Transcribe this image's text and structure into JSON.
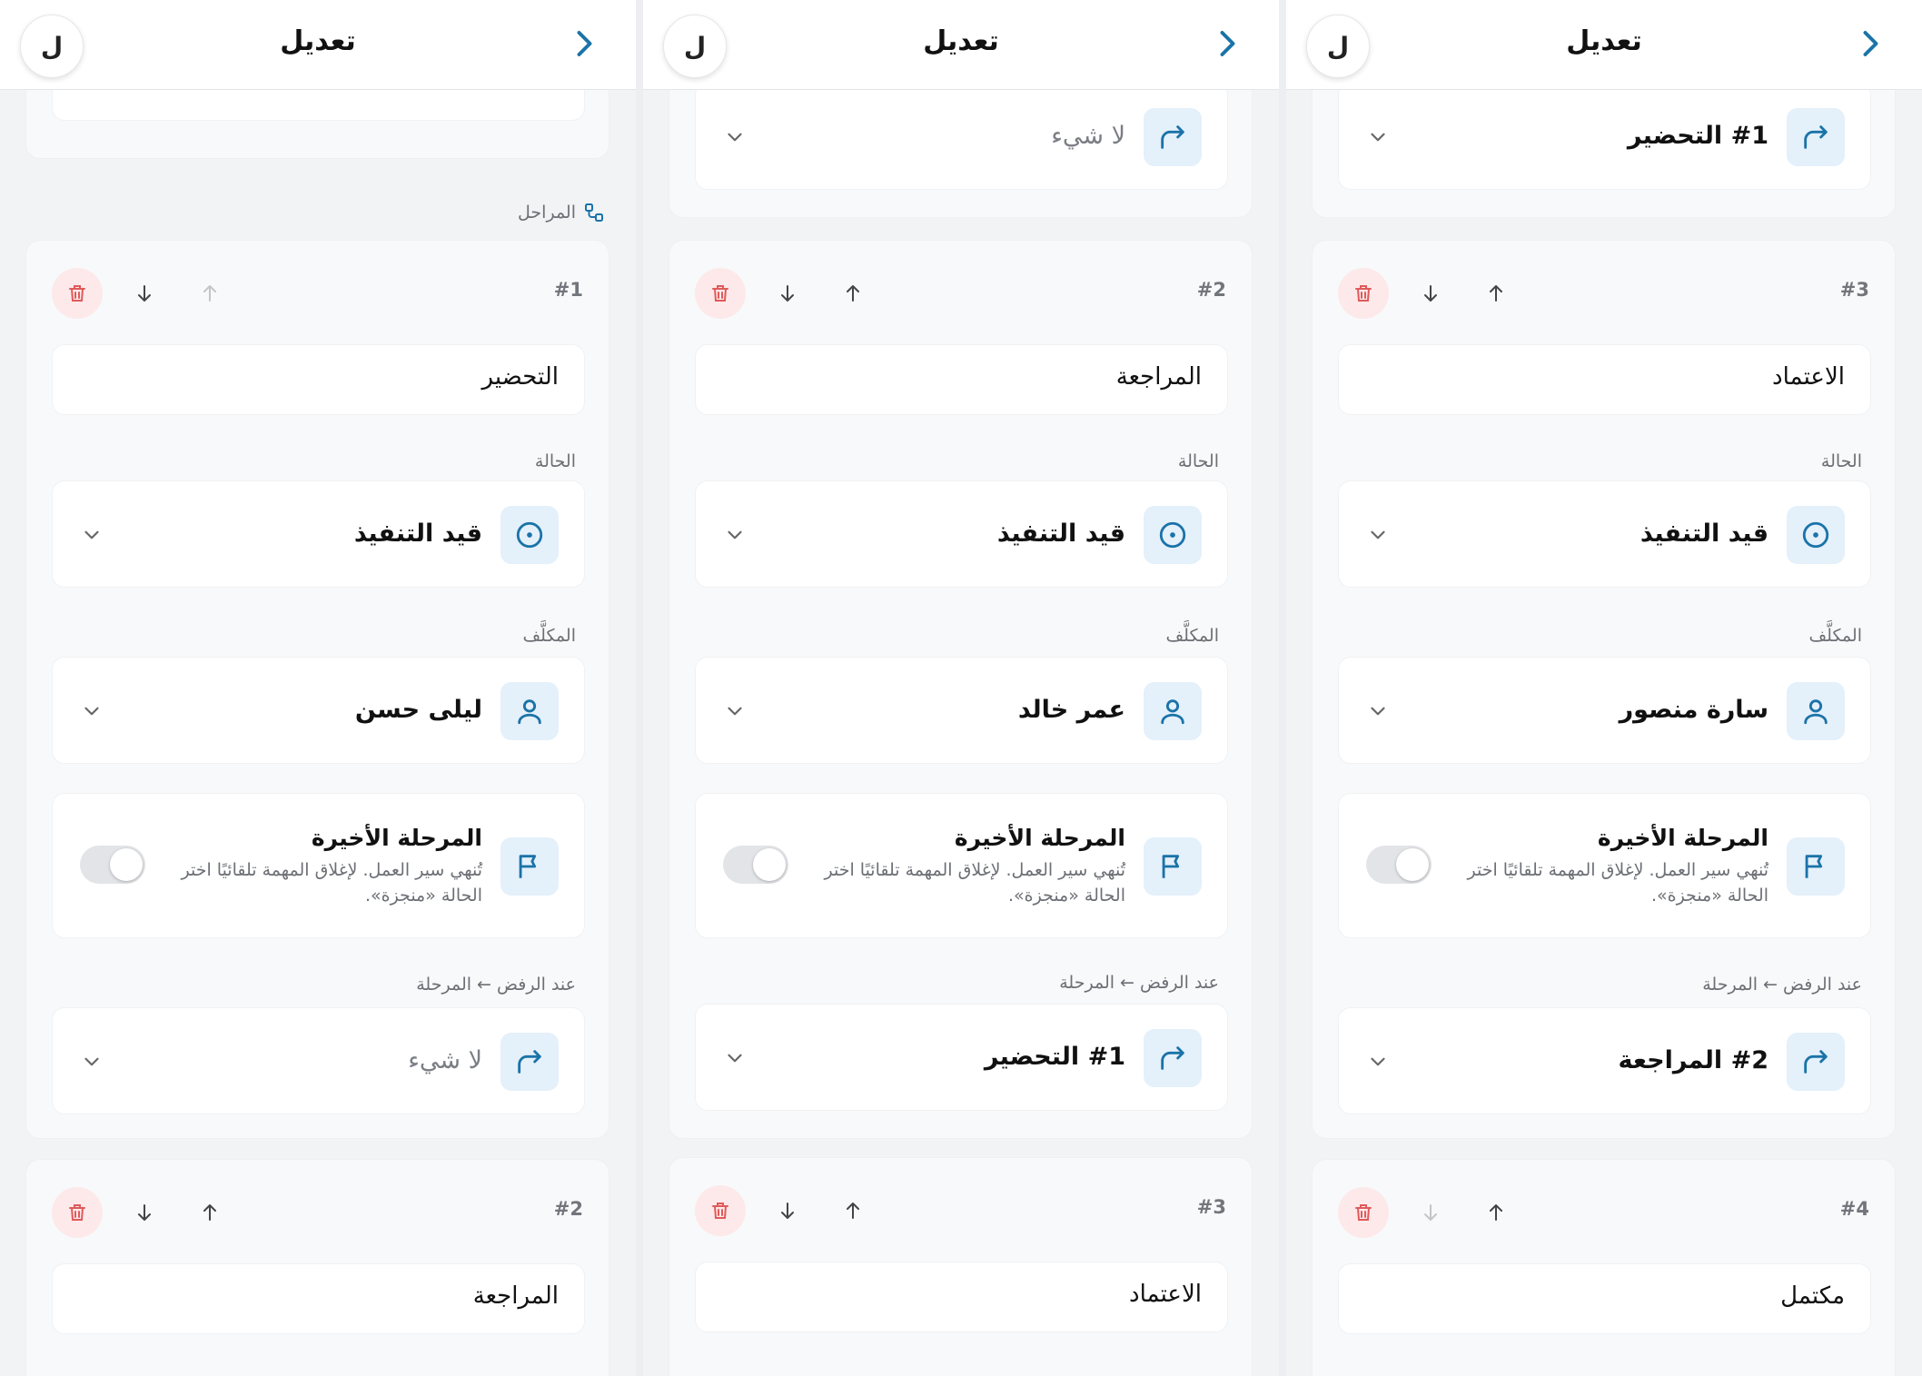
{
  "header": {
    "title": "تعديل",
    "avatar_letter": "ل"
  },
  "labels": {
    "status": "الحالة",
    "assignee": "المكلَّف",
    "final_title": "المرحلة الأخيرة",
    "final_desc": "تُنهي سير العمل. لإغلاق المهمة تلقائيًا اختر الحالة «منجزة».",
    "on_reject": "عند الرفض ← المرحلة",
    "stages": "المراحل"
  },
  "colors": {
    "accent": "#1a73a8",
    "icon_bg": "#e4f0fa",
    "danger": "#e05a5a",
    "danger_bg": "#fde9ea"
  },
  "panels": [
    {
      "top_value": "",
      "step": {
        "num": "#1",
        "name": "التحضير",
        "status": "قيد التنفيذ",
        "assignee": "ليلى حسن",
        "reject_target": "لا شيء",
        "reject_muted": true
      },
      "next": {
        "num": "#2",
        "name": "المراجعة"
      }
    },
    {
      "top_value": "لا شيء",
      "step": {
        "num": "#2",
        "name": "المراجعة",
        "status": "قيد التنفيذ",
        "assignee": "عمر خالد",
        "reject_target": "#1 التحضير",
        "reject_muted": false
      },
      "next": {
        "num": "#3",
        "name": "الاعتماد"
      }
    },
    {
      "top_value": "#1 التحضير",
      "step": {
        "num": "#3",
        "name": "الاعتماد",
        "status": "قيد التنفيذ",
        "assignee": "سارة منصور",
        "reject_target": "#2 المراجعة",
        "reject_muted": false
      },
      "next": {
        "num": "#4",
        "name": "مكتمل"
      }
    }
  ]
}
